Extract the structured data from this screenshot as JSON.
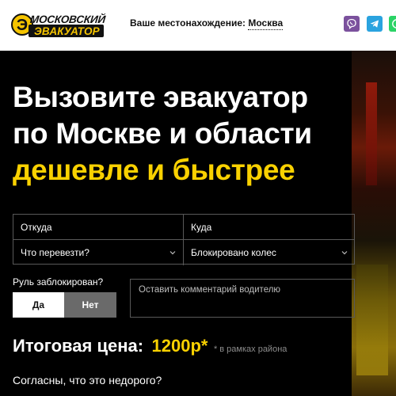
{
  "header": {
    "logo": {
      "line1": "МОСКОВСКИЙ",
      "line2": "ЭВАКУАТОР"
    },
    "location_label": "Ваше местонахождение:",
    "location_city": "Москва",
    "social": [
      "viber-icon",
      "telegram-icon",
      "whatsapp-icon"
    ]
  },
  "hero": {
    "title_line1": "Вызовите эвакуатор",
    "title_line2": "по Москве и области",
    "title_line3": "дешевле и быстрее"
  },
  "form": {
    "from_placeholder": "Откуда",
    "to_placeholder": "Куда",
    "what_select": "Что перевезти?",
    "problem_select": "Блокировано колес",
    "steering_label": "Руль заблокирован?",
    "yes_label": "Да",
    "no_label": "Нет",
    "comment_placeholder": "Оставить комментарий водителю"
  },
  "price": {
    "label": "Итоговая цена:",
    "value": "1200р*",
    "note": "* в рамках района"
  },
  "agree_text": "Согласны, что это недорого?",
  "colors": {
    "accent": "#f9d100",
    "background": "#000000",
    "header_bg": "#ffffff"
  }
}
